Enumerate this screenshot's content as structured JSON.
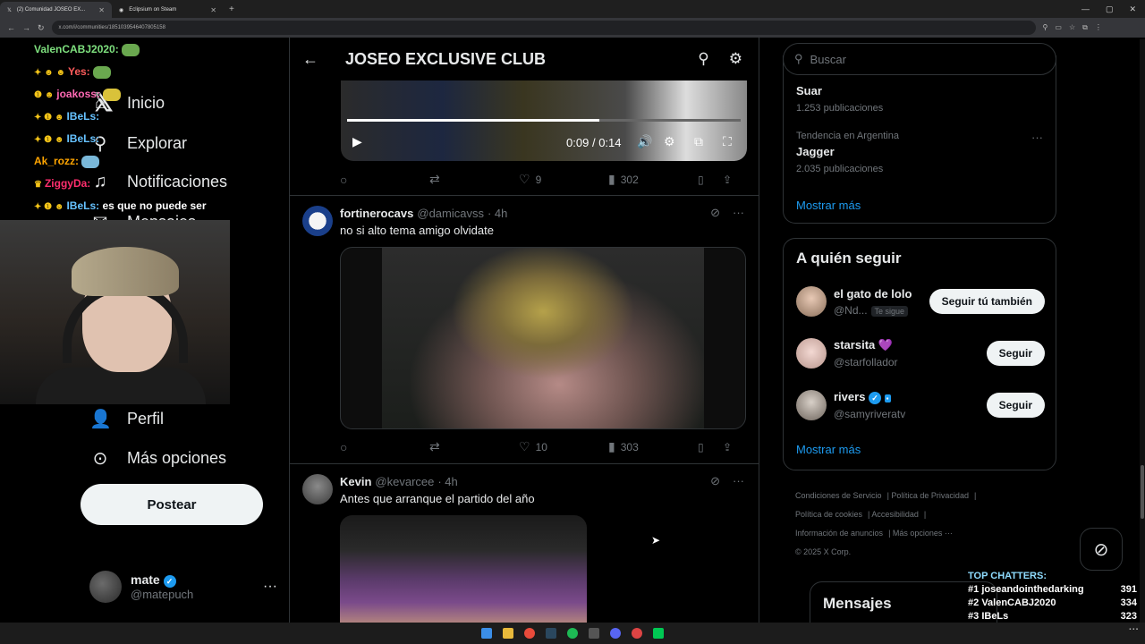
{
  "browser": {
    "tabs": [
      {
        "label": "(2) Comunidad JOSEO EX..."
      },
      {
        "label": "Eclipsium on Steam"
      }
    ],
    "url": "x.com/i/communities/1851039546407805158"
  },
  "nav": {
    "items": [
      {
        "label": "Inicio",
        "icon": "home-icon",
        "glyph": "⌂"
      },
      {
        "label": "Explorar",
        "icon": "search-icon",
        "glyph": "⚲"
      },
      {
        "label": "Notificaciones",
        "icon": "bell-icon",
        "glyph": "♫"
      },
      {
        "label": "Mensajes",
        "icon": "mail-icon",
        "glyph": "✉"
      },
      {
        "label": "Perfil",
        "icon": "person-icon",
        "glyph": "👤"
      },
      {
        "label": "Más opciones",
        "icon": "more-circle-icon",
        "glyph": "⊙"
      }
    ],
    "post_button": "Postear",
    "account": {
      "name": "mate",
      "handle": "@matepuch"
    }
  },
  "stream_chat": [
    {
      "user": "ValenCABJ2020:",
      "color": "#7ee07e",
      "text": ""
    },
    {
      "user": "Yes:",
      "color": "#ff5c5c",
      "text": ""
    },
    {
      "user": "joakoss:",
      "color": "#ff69b4",
      "text": ""
    },
    {
      "user": "IBeLs:",
      "color": "#66c2ff",
      "text": ""
    },
    {
      "user": "IBeLs:",
      "color": "#66c2ff",
      "text": ""
    },
    {
      "user": "Ak_rozz:",
      "color": "#ffa500",
      "text": ""
    },
    {
      "user": "ZiggyDa:",
      "color": "#ff2e6e",
      "text": ""
    },
    {
      "user": "IBeLs:",
      "color": "#66c2ff",
      "text": "es que no puede ser"
    }
  ],
  "header": {
    "title": "JOSEO EXCLUSIVE CLUB"
  },
  "video": {
    "current": "0:09",
    "separator": "/",
    "total": "0:14",
    "progress": 0.64
  },
  "tweets": [
    {
      "replies": "",
      "retweets": "",
      "likes": "9",
      "views": "302"
    },
    {
      "name": "fortinerocavs",
      "handle": "@damicavss",
      "time": "· 4h",
      "text": "no si alto tema amigo olvidate",
      "replies": "",
      "retweets": "",
      "likes": "10",
      "views": "303"
    },
    {
      "name": "Kevin",
      "handle": "@kevarcee",
      "time": "· 4h",
      "text": "Antes que arranque el partido del año"
    }
  ],
  "search": {
    "placeholder": "Buscar"
  },
  "trends": {
    "items": [
      {
        "context": "",
        "title": "Suar",
        "count": "1.253 publicaciones"
      },
      {
        "context": "Tendencia en Argentina",
        "title": "Jagger",
        "count": "2.035 publicaciones"
      }
    ],
    "show_more": "Mostrar más"
  },
  "who_to_follow": {
    "title": "A quién seguir",
    "items": [
      {
        "name": "el gato de lolo",
        "handle": "@Nd...",
        "badge": "Te sigue",
        "button": "Seguir tú también"
      },
      {
        "name": "starsita 💜",
        "handle": "@starfollador",
        "badge": "",
        "button": "Seguir"
      },
      {
        "name": "rivers",
        "handle": "@samyriveratv",
        "badge": "",
        "button": "Seguir"
      }
    ],
    "show_more": "Mostrar más"
  },
  "footer": {
    "links": [
      "Condiciones de Servicio",
      "Política de Privacidad",
      "Política de cookies",
      "Accesibilidad",
      "Información de anuncios",
      "Más opciones ···"
    ],
    "copyright": "© 2025 X Corp."
  },
  "messages": {
    "title": "Mensajes"
  },
  "top_chatters": {
    "title": "TOP CHATTERS:",
    "rows": [
      {
        "rank": "#1",
        "name": "joseandointhedarking",
        "count": "391"
      },
      {
        "rank": "#2",
        "name": "ValenCABJ2020",
        "count": "334"
      },
      {
        "rank": "#3",
        "name": "IBeLs",
        "count": "323"
      }
    ]
  },
  "colors": {
    "accent": "#1d9bf0",
    "background": "#000000",
    "border": "#2f3336",
    "muted": "#71767b"
  }
}
